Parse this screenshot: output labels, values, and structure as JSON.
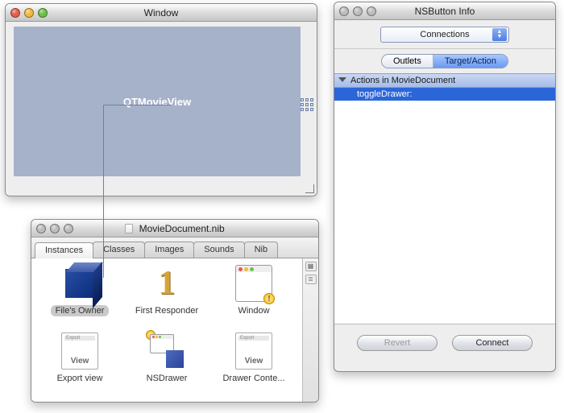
{
  "window_preview": {
    "title": "Window",
    "placeholder_label": "QTMovieView"
  },
  "nib_window": {
    "title": "MovieDocument.nib",
    "tabs": [
      "Instances",
      "Classes",
      "Images",
      "Sounds",
      "Nib"
    ],
    "active_tab": 0,
    "view_label": "View",
    "items": [
      {
        "label": "File's Owner",
        "selected": true
      },
      {
        "label": "First Responder",
        "selected": false
      },
      {
        "label": "Window",
        "selected": false
      },
      {
        "label": "Export view",
        "selected": false
      },
      {
        "label": "NSDrawer",
        "selected": false
      },
      {
        "label": "Drawer Conte...",
        "selected": false
      }
    ]
  },
  "info_window": {
    "title": "NSButton Info",
    "popup_value": "Connections",
    "segments": [
      "Outlets",
      "Target/Action"
    ],
    "active_segment": 1,
    "group_header": "Actions in MovieDocument",
    "rows": [
      "toggleDrawer:"
    ],
    "selected_row": 0,
    "buttons": {
      "revert": "Revert",
      "connect": "Connect"
    }
  }
}
